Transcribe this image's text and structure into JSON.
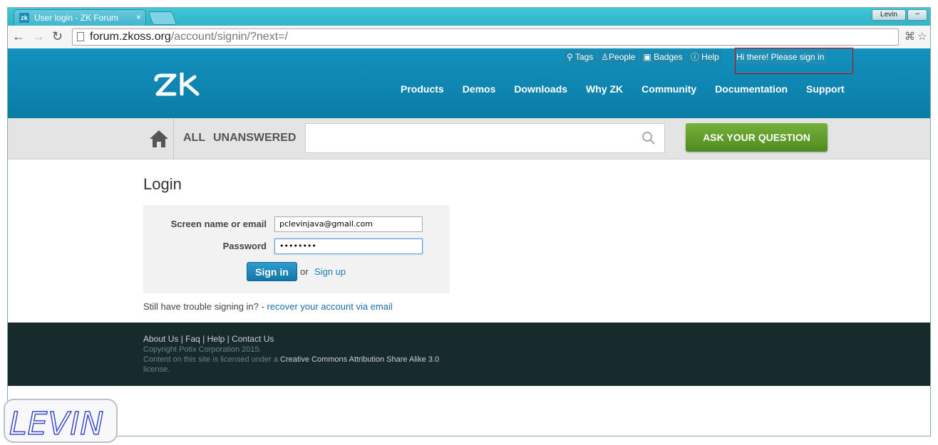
{
  "browser": {
    "tab_title": "User login - ZK Forum",
    "tab_favicon": "zk",
    "tab_close": "×",
    "user_badge": "Levin",
    "minimize": "–",
    "url_host": "forum.zkoss.org",
    "url_path": "/account/signin/?next=/"
  },
  "header": {
    "topnav": [
      {
        "icon": "tag-icon",
        "label": "Tags"
      },
      {
        "icon": "people-icon",
        "label": "People"
      },
      {
        "icon": "badges-icon",
        "label": "Badges"
      },
      {
        "icon": "help-icon",
        "label": "Help"
      }
    ],
    "signin_prompt": "Hi there! Please sign in",
    "logo": "zk",
    "mainnav": [
      "Products",
      "Demos",
      "Downloads",
      "Why ZK",
      "Community",
      "Documentation",
      "Support"
    ]
  },
  "qbar": {
    "tab_all": "ALL",
    "tab_unanswered": "UNANSWERED",
    "search_placeholder": "",
    "ask_button": "ASK YOUR QUESTION"
  },
  "login": {
    "title": "Login",
    "email_label": "Screen name or email",
    "email_value": "pclevinjava@gmail.com",
    "password_label": "Password",
    "password_value": "••••••••",
    "signin_button": "Sign in",
    "or": "or",
    "signup_link": "Sign up",
    "trouble_text": "Still have trouble signing in? - ",
    "recover_link": "recover your account via email"
  },
  "footer": {
    "links": "About Us | Faq | Help | Contact Us",
    "copyright": "Copyright Potix Corporation 2015.",
    "license_prefix": "Content on this site is licensed under a ",
    "license_link": "Creative Commons Attribution Share Alike 3.0",
    "license_suffix": "license."
  },
  "watermark": "LEVIN",
  "colors": {
    "header_blue": "#0a7ca6",
    "ask_green": "#5a9a28",
    "footer_dark": "#172a2c",
    "link_blue": "#1a7fb8"
  }
}
